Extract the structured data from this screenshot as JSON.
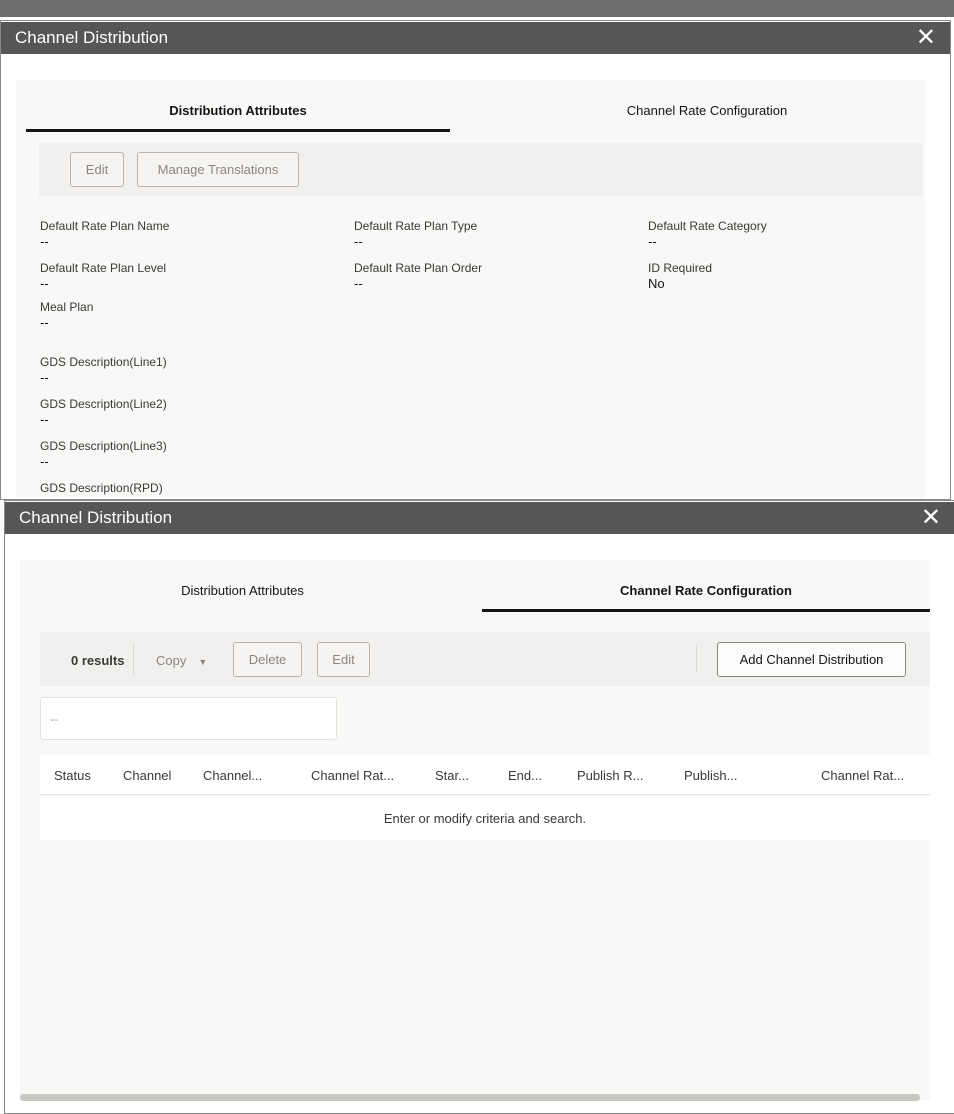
{
  "window1": {
    "title": "Channel Distribution",
    "tabs": [
      {
        "label": "Distribution Attributes",
        "active": true
      },
      {
        "label": "Channel Rate Configuration",
        "active": false
      }
    ],
    "toolbar": {
      "edit": "Edit",
      "manage_translations": "Manage Translations"
    },
    "fields": [
      {
        "label": "Default Rate Plan Name",
        "value": "--"
      },
      {
        "label": "Default Rate Plan Type",
        "value": "--"
      },
      {
        "label": "Default Rate Category",
        "value": "--"
      },
      {
        "label": "Default Rate Plan Level",
        "value": "--"
      },
      {
        "label": "Default Rate Plan Order",
        "value": "--"
      },
      {
        "label": "ID Required",
        "value": "No"
      },
      {
        "label": "Meal Plan",
        "value": "--"
      },
      {
        "label": "GDS Description(Line1)",
        "value": "--"
      },
      {
        "label": "GDS Description(Line2)",
        "value": "--"
      },
      {
        "label": "GDS Description(Line3)",
        "value": "--"
      },
      {
        "label": "GDS Description(RPD)"
      }
    ]
  },
  "window2": {
    "title": "Channel Distribution",
    "tabs": [
      {
        "label": "Distribution Attributes",
        "active": false
      },
      {
        "label": "Channel Rate Configuration",
        "active": true
      }
    ],
    "toolbar": {
      "results": "0 results",
      "copy": "Copy",
      "delete": "Delete",
      "edit": "Edit",
      "add": "Add Channel Distribution"
    },
    "search_value": "--",
    "columns": [
      "Status",
      "Channel",
      "Channel...",
      "Channel Rat...",
      "Star...",
      "End...",
      "Publish R...",
      "Publish...",
      "Channel Rat..."
    ],
    "empty_message": "Enter or modify criteria and search."
  },
  "colors": {
    "titlebar": "#565654",
    "panel": "#f9f8f7",
    "toolbar": "#f1f0ee"
  }
}
